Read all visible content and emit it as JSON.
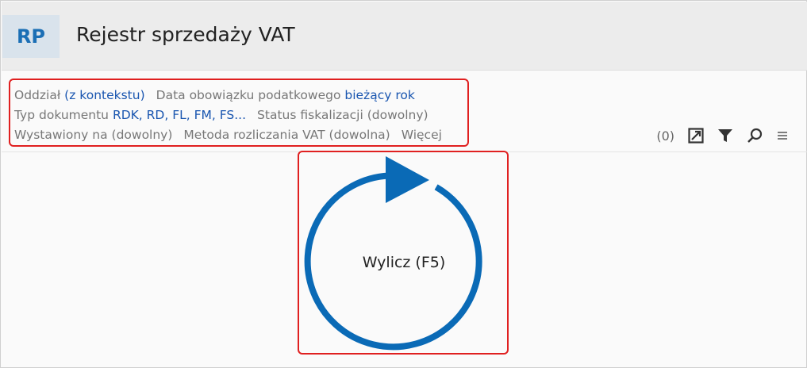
{
  "header": {
    "badge": "RP",
    "title": "Rejestr sprzedaży VAT"
  },
  "filters": {
    "branch_label": "Oddział",
    "branch_value": "(z kontekstu)",
    "tax_date_label": "Data obowiązku podatkowego",
    "tax_date_value": "bieżący rok",
    "doc_type_label": "Typ dokumentu",
    "doc_type_value": "RDK, RD, FL, FM, FS...",
    "fiscal_status": "Status fiskalizacji (dowolny)",
    "issued_to": "Wystawiony na (dowolny)",
    "vat_method": "Metoda rozliczania VAT (dowolna)",
    "more": "Więcej"
  },
  "toolbar": {
    "count": "(0)",
    "icons": [
      "expand-icon",
      "filter-icon",
      "search-icon",
      "menu-icon"
    ]
  },
  "calculate": {
    "label": "Wylicz (F5)",
    "icon": "refresh-arrow-icon"
  },
  "colors": {
    "accent": "#0a6ab6",
    "link": "#1a56b0",
    "highlight": "#e02020"
  }
}
